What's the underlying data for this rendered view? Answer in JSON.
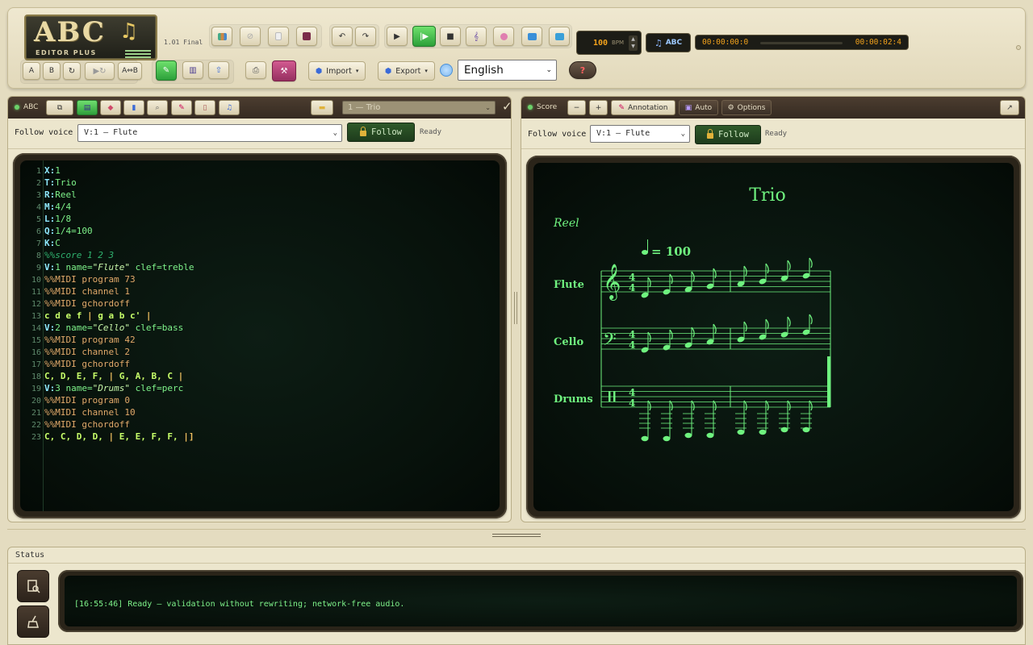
{
  "app": {
    "logo_title": "ABC",
    "logo_subtitle": "EDITOR PLUS",
    "version": "1.01 Final"
  },
  "toolbar": {
    "tempo_value": "100",
    "tempo_unit": "BPM",
    "abc_label": "ABC",
    "time_current": "00:00:00:0",
    "time_total": "00:00:02:4",
    "btn_a": "A",
    "btn_b": "B",
    "btn_ab": "A⇔B",
    "import_label": "Import",
    "export_label": "Export",
    "language_value": "English",
    "help_label": "?"
  },
  "abc_pane": {
    "title": "ABC",
    "file_select_value": "1 — Trio",
    "follow_label": "Follow voice",
    "voice_value": "V:1 — Flute",
    "follow_button": "Follow",
    "state": "Ready"
  },
  "code_lines": [
    {
      "n": "1",
      "parts": [
        [
          "k",
          "X:"
        ],
        [
          "v",
          "1"
        ]
      ]
    },
    {
      "n": "2",
      "parts": [
        [
          "k",
          "T:"
        ],
        [
          "v",
          "Trio"
        ]
      ]
    },
    {
      "n": "3",
      "parts": [
        [
          "k",
          "R:"
        ],
        [
          "v",
          "Reel"
        ]
      ]
    },
    {
      "n": "4",
      "parts": [
        [
          "k",
          "M:"
        ],
        [
          "v",
          "4/4"
        ]
      ]
    },
    {
      "n": "5",
      "parts": [
        [
          "k",
          "L:"
        ],
        [
          "v",
          "1/8"
        ]
      ]
    },
    {
      "n": "6",
      "parts": [
        [
          "k",
          "Q:"
        ],
        [
          "v",
          "1/4=100"
        ]
      ]
    },
    {
      "n": "7",
      "parts": [
        [
          "k",
          "K:"
        ],
        [
          "v",
          "C"
        ]
      ]
    },
    {
      "n": "8",
      "parts": [
        [
          "c",
          "%%score 1 2 3"
        ]
      ]
    },
    {
      "n": "9",
      "parts": [
        [
          "k",
          "V:"
        ],
        [
          "v",
          "1 name="
        ],
        [
          "q",
          "\"Flute\""
        ],
        [
          "v",
          " clef=treble"
        ]
      ]
    },
    {
      "n": "10",
      "parts": [
        [
          "m",
          "%%MIDI program 73"
        ]
      ]
    },
    {
      "n": "11",
      "parts": [
        [
          "m",
          "%%MIDI channel 1"
        ]
      ]
    },
    {
      "n": "12",
      "parts": [
        [
          "m",
          "%%MIDI gchordoff"
        ]
      ]
    },
    {
      "n": "13",
      "parts": [
        [
          "n",
          "c d e f "
        ],
        [
          "bar",
          "|"
        ],
        [
          "n",
          " g a b c' "
        ],
        [
          "bar",
          "|"
        ]
      ]
    },
    {
      "n": "14",
      "parts": [
        [
          "k",
          "V:"
        ],
        [
          "v",
          "2 name="
        ],
        [
          "q",
          "\"Cello\""
        ],
        [
          "v",
          " clef=bass"
        ]
      ]
    },
    {
      "n": "15",
      "parts": [
        [
          "m",
          "%%MIDI program 42"
        ]
      ]
    },
    {
      "n": "16",
      "parts": [
        [
          "m",
          "%%MIDI channel 2"
        ]
      ]
    },
    {
      "n": "17",
      "parts": [
        [
          "m",
          "%%MIDI gchordoff"
        ]
      ]
    },
    {
      "n": "18",
      "parts": [
        [
          "n",
          "C, D, E, F, "
        ],
        [
          "bar",
          "|"
        ],
        [
          "n",
          " G, A, B, C "
        ],
        [
          "bar",
          "|"
        ]
      ]
    },
    {
      "n": "19",
      "parts": [
        [
          "k",
          "V:"
        ],
        [
          "v",
          "3 name="
        ],
        [
          "q",
          "\"Drums\""
        ],
        [
          "v",
          " clef=perc"
        ]
      ]
    },
    {
      "n": "20",
      "parts": [
        [
          "m",
          "%%MIDI program 0"
        ]
      ]
    },
    {
      "n": "21",
      "parts": [
        [
          "m",
          "%%MIDI channel 10"
        ]
      ]
    },
    {
      "n": "22",
      "parts": [
        [
          "m",
          "%%MIDI gchordoff"
        ]
      ]
    },
    {
      "n": "23",
      "parts": [
        [
          "n",
          "C, C, D, D, "
        ],
        [
          "bar",
          "|"
        ],
        [
          "n",
          " E, E, F, F, "
        ],
        [
          "bar",
          "|]"
        ]
      ]
    }
  ],
  "score_pane": {
    "title": "Score",
    "minus": "−",
    "plus": "+",
    "annotation_label": "Annotation",
    "auto_label": "Auto",
    "options_label": "Options",
    "follow_label": "Follow voice",
    "voice_value": "V:1 — Flute",
    "follow_button": "Follow",
    "state": "Ready"
  },
  "score": {
    "title": "Trio",
    "rhythm": "Reel",
    "tempo": "= 100",
    "staves": [
      "Flute",
      "Cello",
      "Drums"
    ],
    "time_sig_top": "4",
    "time_sig_bottom": "4"
  },
  "status": {
    "title": "Status",
    "log": "[16:55:46] Ready — validation without rewriting; network-free audio."
  },
  "colors": {
    "accent_green": "#7ef28a",
    "crt_bg": "#07110b",
    "header_brown": "#3f3228",
    "time_orange": "#f2a21c"
  }
}
